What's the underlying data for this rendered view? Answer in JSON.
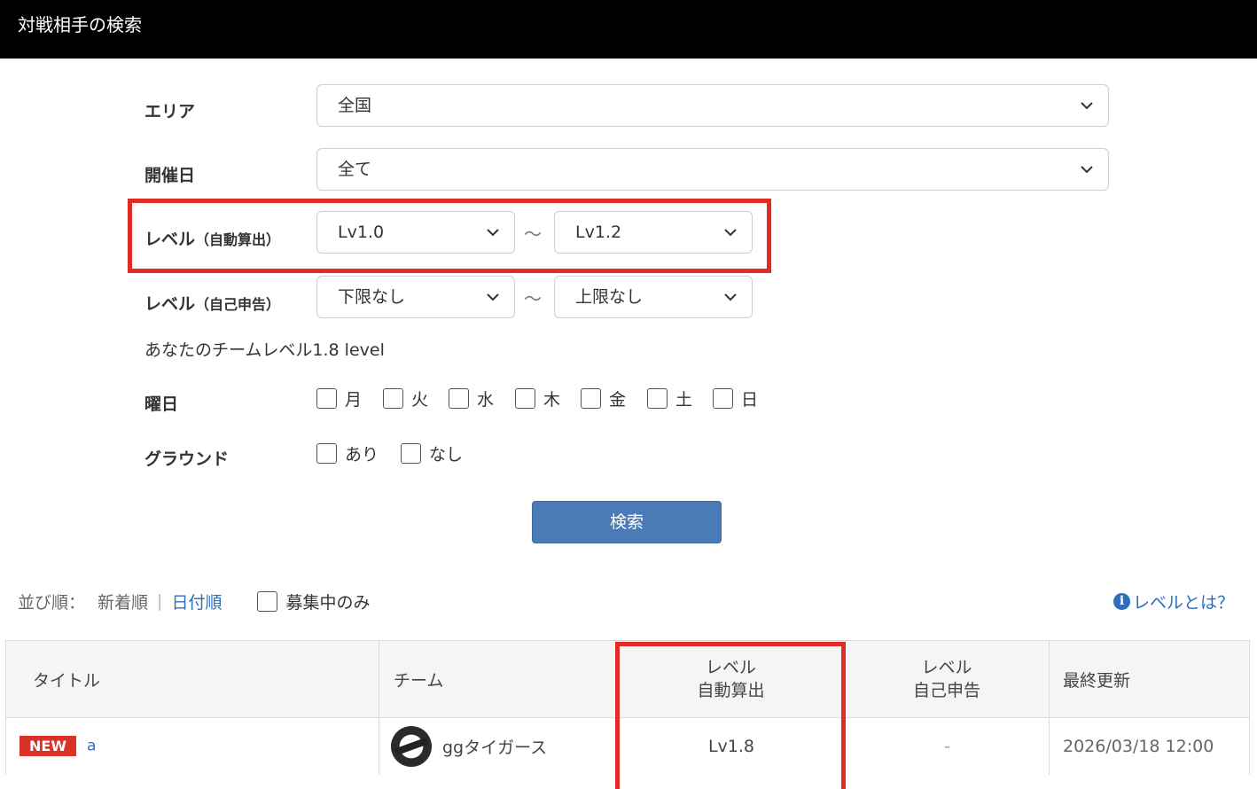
{
  "header": {
    "title": "対戦相手の検索"
  },
  "form": {
    "area": {
      "label": "エリア",
      "value": "全国"
    },
    "date": {
      "label": "開催日",
      "value": "全て"
    },
    "level_auto": {
      "label": "レベル",
      "sub": "（自動算出）",
      "from": "Lv1.0",
      "tilde": "〜",
      "to": "Lv1.2"
    },
    "level_self": {
      "label": "レベル",
      "sub": "（自己申告）",
      "from": "下限なし",
      "tilde": "〜",
      "to": "上限なし"
    },
    "team_level_text": "あなたのチームレベル1.8 level",
    "weekday": {
      "label": "曜日",
      "days": [
        "月",
        "火",
        "水",
        "木",
        "金",
        "土",
        "日"
      ]
    },
    "ground": {
      "label": "グラウンド",
      "options": [
        "あり",
        "なし"
      ]
    },
    "search_button": "検索"
  },
  "sort": {
    "label": "並び順：",
    "newest": "新着順",
    "separator": "|",
    "by_date": "日付順",
    "recruiting_only": "募集中のみ",
    "level_help": "レベルとは？",
    "info_icon_glyph": "i"
  },
  "table": {
    "headers": {
      "title": "タイトル",
      "team": "チーム",
      "level_auto_1": "レベル",
      "level_auto_2": "自動算出",
      "level_self_1": "レベル",
      "level_self_2": "自己申告",
      "updated": "最終更新"
    },
    "rows": [
      {
        "badge": "NEW",
        "title": "a",
        "team": "ggタイガース",
        "level_auto": "Lv1.8",
        "level_self": "-",
        "updated": "2026/03/18 12:00"
      }
    ]
  },
  "colors": {
    "accent_blue": "#4a7bb7",
    "link_blue": "#2f6ebd",
    "highlight_red": "#e02b27",
    "badge_red": "#d9322b"
  }
}
